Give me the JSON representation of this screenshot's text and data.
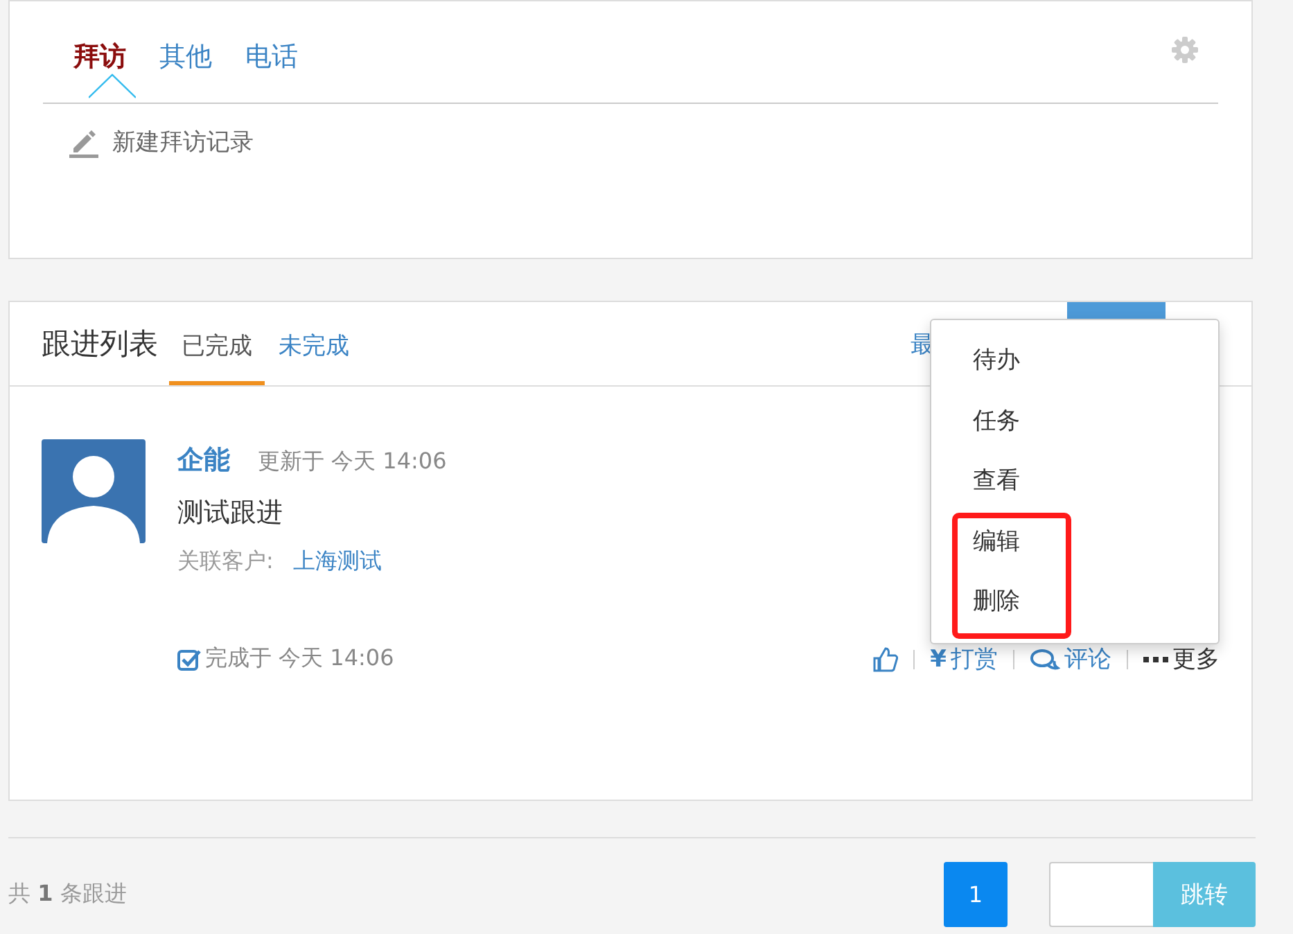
{
  "top_tabs": [
    {
      "label": "拜访",
      "selected": true
    },
    {
      "label": "其他",
      "selected": false
    },
    {
      "label": "电话",
      "selected": false
    }
  ],
  "new_record": "新建拜访记录",
  "list": {
    "title": "跟进列表",
    "tabs": [
      {
        "label": "已完成",
        "selected": true
      },
      {
        "label": "未完成",
        "selected": false
      }
    ],
    "partial_link": "最"
  },
  "menu": {
    "items": [
      {
        "label": "待办",
        "highlighted": false
      },
      {
        "label": "任务",
        "highlighted": false
      },
      {
        "label": "查看",
        "highlighted": false
      },
      {
        "label": "编辑",
        "highlighted": true
      },
      {
        "label": "删除",
        "highlighted": true
      }
    ]
  },
  "entry": {
    "author": "企能",
    "updated": "更新于 今天 14:06",
    "content": "测试跟进",
    "customer_label": "关联客户:",
    "customer": "上海测试",
    "done": "完成于 今天 14:06",
    "actions": [
      {
        "kind": "like"
      },
      {
        "kind": "reward",
        "icon": "¥",
        "label": "打赏"
      },
      {
        "kind": "comment",
        "label": "评论"
      },
      {
        "kind": "more",
        "label": "更多"
      }
    ]
  },
  "footer": {
    "total": "共 **1** 条跟进",
    "pages": [
      {
        "label": "1",
        "selected": true
      }
    ],
    "jump": "跳转"
  }
}
